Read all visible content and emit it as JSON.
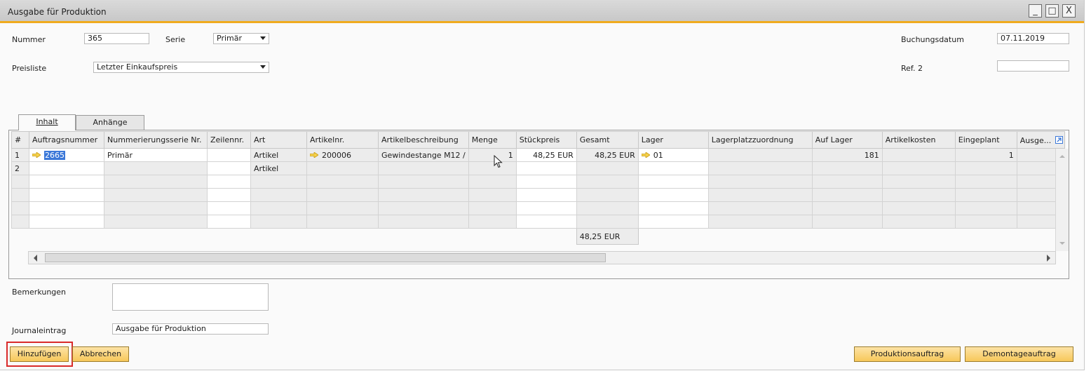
{
  "window": {
    "title": "Ausgabe für Produktion",
    "controls": [
      "_",
      "□",
      "X"
    ]
  },
  "header": {
    "nummer": {
      "label": "Nummer",
      "value": "365"
    },
    "serie": {
      "label": "Serie",
      "value": "Primär"
    },
    "preisliste": {
      "label": "Preisliste",
      "value": "Letzter Einkaufspreis"
    },
    "buchungsdatum": {
      "label": "Buchungsdatum",
      "value": "07.11.2019"
    },
    "ref2": {
      "label": "Ref. 2",
      "value": ""
    }
  },
  "tabs": [
    {
      "label": "Inhalt",
      "active": true
    },
    {
      "label": "Anhänge",
      "active": false
    }
  ],
  "grid": {
    "columns": [
      "#",
      "Auftragsnummer",
      "Nummerierungsserie Nr.",
      "Zeilennr.",
      "Art",
      "Artikelnr.",
      "Artikelbeschreibung",
      "Menge",
      "Stückpreis",
      "Gesamt",
      "Lager",
      "Lagerplatzzuordnung",
      "Auf Lager",
      "Artikelkosten",
      "Eingeplant",
      "Ausge..."
    ],
    "rows": [
      {
        "num": "1",
        "auftragsnummer": "2665",
        "serie": "Primär",
        "zeilennr": "",
        "art": "Artikel",
        "artikelnr": "200006",
        "beschreibung": "Gewindestange M12 /",
        "menge": "1",
        "stueckpreis": "48,25 EUR",
        "gesamt": "48,25 EUR",
        "lager": "01",
        "lagerplatz": "",
        "auf_lager": "181",
        "artikelkosten": "",
        "eingeplant": "1",
        "ausge": ""
      },
      {
        "num": "2",
        "auftragsnummer": "",
        "serie": "",
        "zeilennr": "",
        "art": "Artikel",
        "artikelnr": "",
        "beschreibung": "",
        "menge": "",
        "stueckpreis": "",
        "gesamt": "",
        "lager": "",
        "lagerplatz": "",
        "auf_lager": "",
        "artikelkosten": "",
        "eingeplant": "",
        "ausge": ""
      }
    ],
    "total": "48,25 EUR"
  },
  "footer": {
    "bemerkungen": {
      "label": "Bemerkungen",
      "value": ""
    },
    "journaleintrag": {
      "label": "Journaleintrag",
      "value": "Ausgabe für Produktion"
    }
  },
  "buttons": {
    "add": "Hinzufügen",
    "cancel": "Abbrechen",
    "production_order": "Produktionsauftrag",
    "disassembly_order": "Demontageauftrag"
  },
  "colors": {
    "accent": "#f0ab1e",
    "button": "#f7c85a",
    "highlight": "#d92a2a",
    "selection": "#3b78d8"
  },
  "icons": {
    "link_arrow": "yellow-link-arrow-icon",
    "expand": "expand-arrow-icon"
  }
}
